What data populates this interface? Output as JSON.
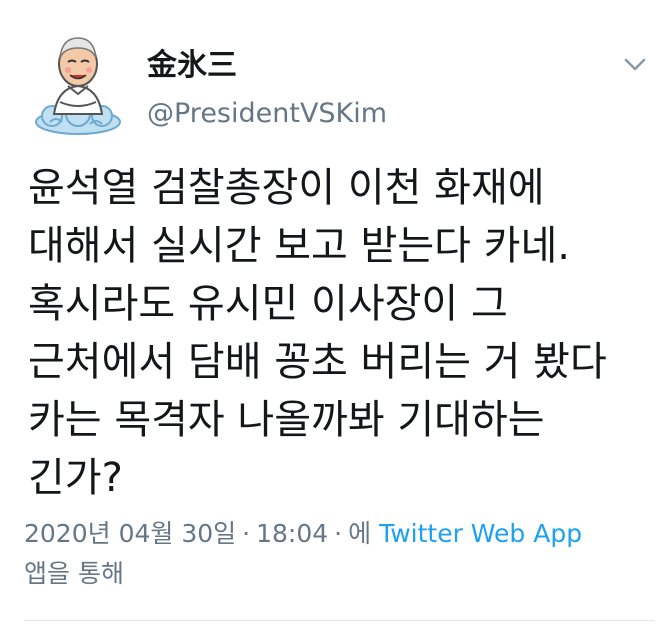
{
  "author": {
    "display_name": "金氷三",
    "handle": "@PresidentVSKim"
  },
  "tweet": {
    "lines": [
      "윤석열 검찰총장이 이천 화재에",
      "대해서 실시간 보고 받는다 카네.",
      "혹시라도 유시민 이사장이 그",
      "근처에서 담배 꽁초 버리는 거 봤다",
      "카는 목격자 나올까봐 기대하는",
      "긴가?"
    ]
  },
  "meta": {
    "date": "2020년 04월 30일",
    "separator": "·",
    "time": "18:04",
    "prefix": "에",
    "source": "Twitter Web App",
    "suffix": "앱을 통해"
  },
  "icons": {
    "avatar": "caricature-avatar",
    "menu": "chevron-down-icon"
  },
  "colors": {
    "text": "#14171a",
    "secondary": "#657786",
    "link": "#1da1f2",
    "divider": "#e1e8ed"
  }
}
